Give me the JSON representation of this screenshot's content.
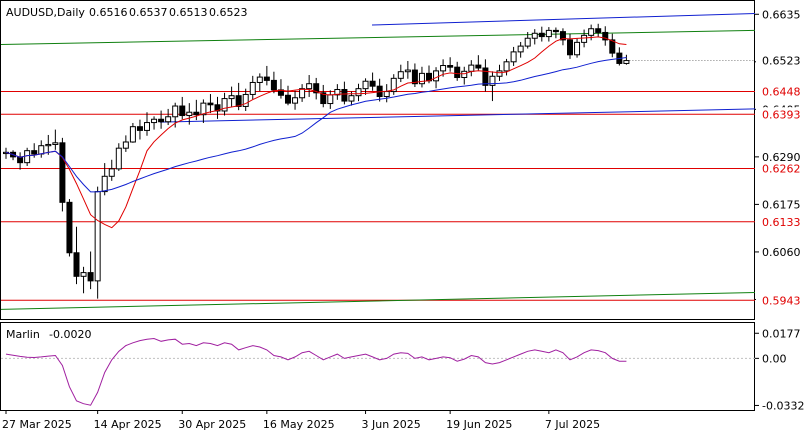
{
  "chart_data": [
    {
      "type": "candlestick",
      "title": "AUDUSD,Daily",
      "header_values": [
        "0.6516",
        "0.6537",
        "0.6513",
        "0.6523"
      ],
      "ylim": [
        0.5905,
        0.6655
      ],
      "y_ticks": [
        "0.6635",
        "0.6520",
        "0.6405",
        "0.6290",
        "0.6175",
        "0.6060",
        "0.5945"
      ],
      "x_ticks": [
        "27 Mar 2025",
        "14 Apr 2025",
        "30 Apr 2025",
        "16 May 2025",
        "3 Jun 2025",
        "19 Jun 2025",
        "7 Jul 2025"
      ],
      "current_price": "0.6523",
      "price_levels": [
        {
          "value": 0.6448,
          "label": "0.6448",
          "color": "#e00000"
        },
        {
          "value": 0.6393,
          "label": "0.6393",
          "color": "#e00000"
        },
        {
          "value": 0.6262,
          "label": "0.6262",
          "color": "#e00000"
        },
        {
          "value": 0.6133,
          "label": "0.6133",
          "color": "#e00000"
        },
        {
          "value": 0.5943,
          "label": "0.5943",
          "color": "#e00000"
        }
      ],
      "colors": {
        "fast_ma": "#e00000",
        "slow_ma": "#1020d0",
        "channel": "#1020d0",
        "green": "#108010",
        "levels": "#e00000",
        "marlin": "#a020a0",
        "candle": "#000000"
      },
      "candles_ohlc": [
        [
          0.6298,
          0.6312,
          0.6285,
          0.6301
        ],
        [
          0.6301,
          0.6306,
          0.6282,
          0.629
        ],
        [
          0.629,
          0.6301,
          0.6259,
          0.6276
        ],
        [
          0.6276,
          0.6312,
          0.6268,
          0.6305
        ],
        [
          0.6305,
          0.6323,
          0.6288,
          0.6297
        ],
        [
          0.6297,
          0.633,
          0.6288,
          0.6317
        ],
        [
          0.6317,
          0.6343,
          0.6295,
          0.632
        ],
        [
          0.632,
          0.6356,
          0.6307,
          0.6324
        ],
        [
          0.6324,
          0.6336,
          0.6158,
          0.618
        ],
        [
          0.618,
          0.6188,
          0.6049,
          0.6058
        ],
        [
          0.6058,
          0.6121,
          0.5982,
          0.6001
        ],
        [
          0.6001,
          0.6024,
          0.596,
          0.601
        ],
        [
          0.601,
          0.6061,
          0.597,
          0.599
        ],
        [
          0.599,
          0.6218,
          0.5947,
          0.6206
        ],
        [
          0.6206,
          0.6275,
          0.6197,
          0.6243
        ],
        [
          0.6243,
          0.6283,
          0.6232,
          0.6261
        ],
        [
          0.6261,
          0.6323,
          0.6256,
          0.6311
        ],
        [
          0.6311,
          0.6342,
          0.6302,
          0.6326
        ],
        [
          0.6326,
          0.6372,
          0.6324,
          0.6363
        ],
        [
          0.6363,
          0.638,
          0.6332,
          0.6354
        ],
        [
          0.6354,
          0.6398,
          0.6341,
          0.6373
        ],
        [
          0.6373,
          0.6388,
          0.6356,
          0.6381
        ],
        [
          0.6381,
          0.6402,
          0.6358,
          0.6375
        ],
        [
          0.6375,
          0.6406,
          0.6367,
          0.6387
        ],
        [
          0.6387,
          0.6421,
          0.6361,
          0.6413
        ],
        [
          0.6413,
          0.6435,
          0.6381,
          0.639
        ],
        [
          0.639,
          0.642,
          0.6368,
          0.6398
        ],
        [
          0.6398,
          0.6428,
          0.6379,
          0.6392
        ],
        [
          0.6392,
          0.6429,
          0.6372,
          0.642
        ],
        [
          0.642,
          0.6442,
          0.6396,
          0.6416
        ],
        [
          0.6416,
          0.6435,
          0.6382,
          0.6401
        ],
        [
          0.6401,
          0.6445,
          0.639,
          0.6431
        ],
        [
          0.6431,
          0.646,
          0.6411,
          0.6438
        ],
        [
          0.6438,
          0.6469,
          0.6403,
          0.6412
        ],
        [
          0.6412,
          0.6455,
          0.6401,
          0.6441
        ],
        [
          0.6441,
          0.6486,
          0.6429,
          0.647
        ],
        [
          0.647,
          0.6492,
          0.6449,
          0.6483
        ],
        [
          0.6483,
          0.651,
          0.6463,
          0.6475
        ],
        [
          0.6475,
          0.6496,
          0.6444,
          0.6452
        ],
        [
          0.6452,
          0.6478,
          0.6431,
          0.6439
        ],
        [
          0.6439,
          0.6462,
          0.6415,
          0.642
        ],
        [
          0.642,
          0.645,
          0.6404,
          0.6433
        ],
        [
          0.6433,
          0.6466,
          0.6423,
          0.6455
        ],
        [
          0.6455,
          0.6488,
          0.6435,
          0.6467
        ],
        [
          0.6467,
          0.6481,
          0.6429,
          0.6445
        ],
        [
          0.6445,
          0.6464,
          0.641,
          0.6419
        ],
        [
          0.6419,
          0.6451,
          0.6406,
          0.644
        ],
        [
          0.644,
          0.6466,
          0.6428,
          0.6453
        ],
        [
          0.6453,
          0.6472,
          0.6417,
          0.6425
        ],
        [
          0.6425,
          0.6448,
          0.6414,
          0.6438
        ],
        [
          0.6438,
          0.6467,
          0.6425,
          0.6455
        ],
        [
          0.6455,
          0.648,
          0.644,
          0.6473
        ],
        [
          0.6473,
          0.6494,
          0.645,
          0.6461
        ],
        [
          0.6461,
          0.6479,
          0.6424,
          0.6436
        ],
        [
          0.6436,
          0.6466,
          0.6422,
          0.6448
        ],
        [
          0.6448,
          0.649,
          0.644,
          0.648
        ],
        [
          0.648,
          0.6513,
          0.6471,
          0.6496
        ],
        [
          0.6496,
          0.6522,
          0.6479,
          0.65
        ],
        [
          0.65,
          0.6516,
          0.6459,
          0.6467
        ],
        [
          0.6467,
          0.6508,
          0.6458,
          0.6492
        ],
        [
          0.6492,
          0.6511,
          0.6468,
          0.6474
        ],
        [
          0.6474,
          0.6507,
          0.6456,
          0.6498
        ],
        [
          0.6498,
          0.6526,
          0.6484,
          0.6511
        ],
        [
          0.6511,
          0.6531,
          0.6496,
          0.6507
        ],
        [
          0.6507,
          0.652,
          0.6474,
          0.6482
        ],
        [
          0.6482,
          0.6508,
          0.6465,
          0.6497
        ],
        [
          0.6497,
          0.6524,
          0.6485,
          0.6512
        ],
        [
          0.6512,
          0.6536,
          0.6499,
          0.6505
        ],
        [
          0.6505,
          0.6526,
          0.6448,
          0.6463
        ],
        [
          0.6463,
          0.6497,
          0.6425,
          0.6485
        ],
        [
          0.6485,
          0.6513,
          0.6474,
          0.6498
        ],
        [
          0.6498,
          0.6527,
          0.6487,
          0.652
        ],
        [
          0.652,
          0.6556,
          0.651,
          0.6544
        ],
        [
          0.6544,
          0.6568,
          0.653,
          0.6558
        ],
        [
          0.6558,
          0.6592,
          0.6552,
          0.6577
        ],
        [
          0.6577,
          0.6599,
          0.6562,
          0.6589
        ],
        [
          0.6589,
          0.6605,
          0.6569,
          0.6581
        ],
        [
          0.6581,
          0.6604,
          0.6569,
          0.6596
        ],
        [
          0.6596,
          0.6603,
          0.6577,
          0.6593
        ],
        [
          0.6593,
          0.6601,
          0.656,
          0.6573
        ],
        [
          0.6573,
          0.6588,
          0.6527,
          0.6537
        ],
        [
          0.6537,
          0.6576,
          0.653,
          0.6567
        ],
        [
          0.6567,
          0.6598,
          0.6555,
          0.6584
        ],
        [
          0.6584,
          0.661,
          0.6572,
          0.66
        ],
        [
          0.66,
          0.6612,
          0.6579,
          0.6591
        ],
        [
          0.6591,
          0.6606,
          0.6559,
          0.6573
        ],
        [
          0.6573,
          0.6588,
          0.6531,
          0.6541
        ],
        [
          0.6541,
          0.6555,
          0.6511,
          0.6516
        ],
        [
          0.6516,
          0.6537,
          0.6513,
          0.6523
        ]
      ],
      "indicator": {
        "name": "Marlin",
        "value": "-0.0020",
        "ylim": [
          -0.035,
          0.02
        ],
        "y_ticks": [
          "0.0177",
          "0.00",
          "-0.0332"
        ],
        "values": [
          0.003,
          0.0022,
          0.0014,
          0.0008,
          0.0006,
          0.001,
          0.0016,
          0.002,
          -0.005,
          -0.02,
          -0.03,
          -0.032,
          -0.033,
          -0.024,
          -0.01,
          -0.001,
          0.005,
          0.009,
          0.011,
          0.0125,
          0.0135,
          0.014,
          0.012,
          0.013,
          0.0135,
          0.01,
          0.0105,
          0.009,
          0.011,
          0.0105,
          0.009,
          0.011,
          0.01,
          0.006,
          0.0075,
          0.009,
          0.008,
          0.006,
          0.002,
          0.001,
          -0.001,
          0.001,
          0.004,
          0.005,
          0.002,
          -0.001,
          0.001,
          0.003,
          0.0,
          0.001,
          0.002,
          0.003,
          0.001,
          -0.001,
          0.0,
          0.003,
          0.004,
          0.0035,
          0.0,
          0.001,
          -0.001,
          0.0,
          0.001,
          0.0005,
          -0.002,
          -0.0005,
          0.002,
          0.001,
          -0.003,
          -0.004,
          -0.003,
          -0.001,
          0.001,
          0.003,
          0.005,
          0.006,
          0.005,
          0.004,
          0.006,
          0.004,
          -0.001,
          0.001,
          0.004,
          0.006,
          0.0055,
          0.004,
          0.0,
          -0.002,
          -0.002
        ]
      }
    }
  ]
}
